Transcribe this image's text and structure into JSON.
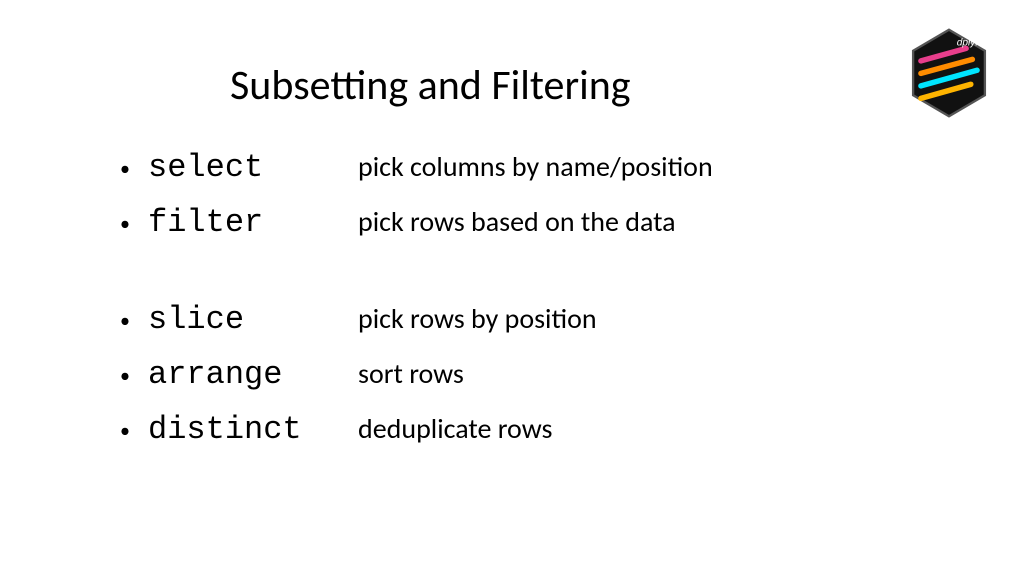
{
  "title": "Subsetting and Filtering",
  "logo": {
    "name": "dplyr",
    "label": "dplyr"
  },
  "items": [
    {
      "fn": "select",
      "desc": "pick columns by name/position",
      "gap": false
    },
    {
      "fn": "filter",
      "desc": "pick rows based on the data",
      "gap": false
    },
    {
      "fn": "slice",
      "desc": "pick rows by position",
      "gap": true
    },
    {
      "fn": "arrange",
      "desc": "sort rows",
      "gap": false
    },
    {
      "fn": "distinct",
      "desc": "deduplicate rows",
      "gap": false
    }
  ]
}
